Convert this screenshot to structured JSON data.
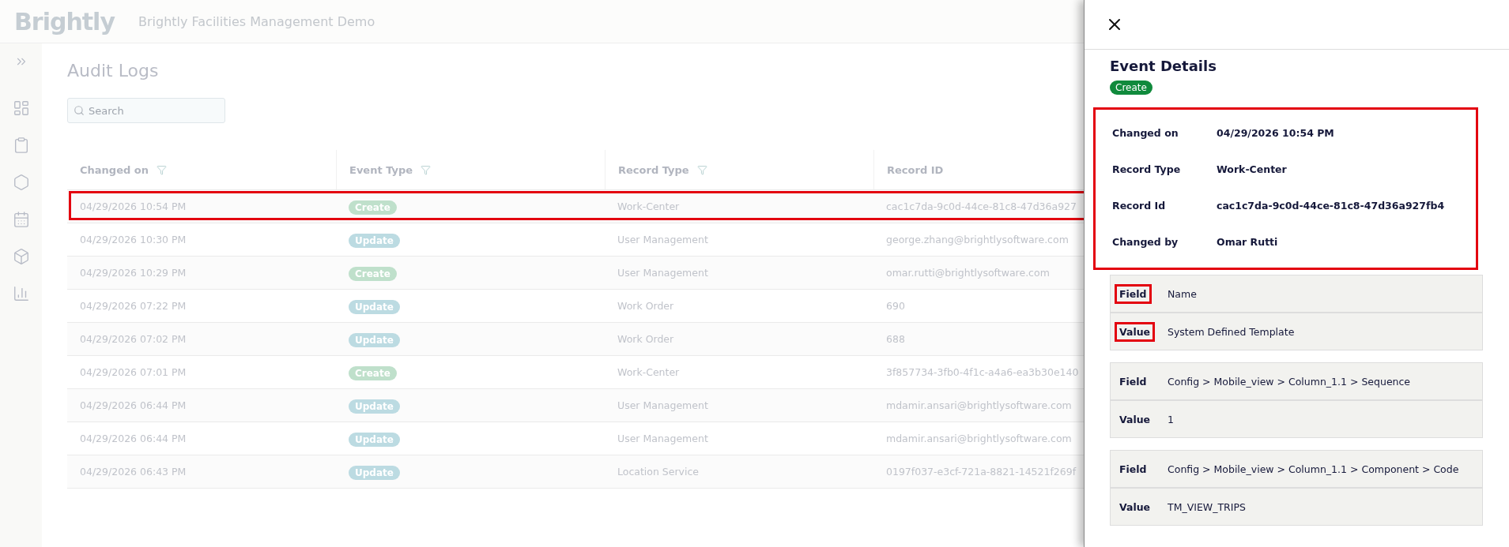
{
  "header": {
    "logo": "Brightly",
    "app_title": "Brightly Facilities Management Demo"
  },
  "sidebar": {
    "items": [
      {
        "kind": "expand"
      },
      {
        "kind": "dashboard"
      },
      {
        "kind": "clipboard"
      },
      {
        "kind": "hexagon"
      },
      {
        "kind": "calendar"
      },
      {
        "kind": "cube"
      },
      {
        "kind": "chart"
      }
    ]
  },
  "page": {
    "title": "Audit Logs",
    "search": {
      "placeholder": "Search"
    }
  },
  "table": {
    "columns": [
      {
        "label": "Changed on",
        "filter": true
      },
      {
        "label": "Event Type",
        "filter": true
      },
      {
        "label": "Record Type",
        "filter": true
      },
      {
        "label": "Record ID",
        "filter": false
      }
    ],
    "rows": [
      {
        "changed_on": "04/29/2026 10:54 PM",
        "event_type": "Create",
        "kind": "create",
        "record_type": "Work-Center",
        "record_id": "cac1c7da-9c0d-44ce-81c8-47d36a927",
        "highlighted": true
      },
      {
        "changed_on": "04/29/2026 10:30 PM",
        "event_type": "Update",
        "kind": "update",
        "record_type": "User Management",
        "record_id": "george.zhang@brightlysoftware.com",
        "highlighted": false
      },
      {
        "changed_on": "04/29/2026 10:29 PM",
        "event_type": "Create",
        "kind": "create",
        "record_type": "User Management",
        "record_id": "omar.rutti@brightlysoftware.com",
        "highlighted": false
      },
      {
        "changed_on": "04/29/2026 07:22 PM",
        "event_type": "Update",
        "kind": "update",
        "record_type": "Work Order",
        "record_id": "690",
        "highlighted": false
      },
      {
        "changed_on": "04/29/2026 07:02 PM",
        "event_type": "Update",
        "kind": "update",
        "record_type": "Work Order",
        "record_id": "688",
        "highlighted": false
      },
      {
        "changed_on": "04/29/2026 07:01 PM",
        "event_type": "Create",
        "kind": "create",
        "record_type": "Work-Center",
        "record_id": "3f857734-3fb0-4f1c-a4a6-ea3b30e140",
        "highlighted": false
      },
      {
        "changed_on": "04/29/2026 06:44 PM",
        "event_type": "Update",
        "kind": "update",
        "record_type": "User Management",
        "record_id": "mdamir.ansari@brightlysoftware.com",
        "highlighted": false
      },
      {
        "changed_on": "04/29/2026 06:44 PM",
        "event_type": "Update",
        "kind": "update",
        "record_type": "User Management",
        "record_id": "mdamir.ansari@brightlysoftware.com",
        "highlighted": false
      },
      {
        "changed_on": "04/29/2026 06:43 PM",
        "event_type": "Update",
        "kind": "update",
        "record_type": "Location Service",
        "record_id": "0197f037-e3cf-721a-8821-14521f269f",
        "highlighted": false
      }
    ]
  },
  "panel": {
    "title": "Event Details",
    "badge": {
      "label": "Create",
      "kind": "create"
    },
    "summary": {
      "highlighted": true,
      "items": [
        {
          "label": "Changed on",
          "value": "04/29/2026 10:54 PM"
        },
        {
          "label": "Record Type",
          "value": "Work-Center"
        },
        {
          "label": "Record Id",
          "value": "cac1c7da-9c0d-44ce-81c8-47d36a927fb4"
        },
        {
          "label": "Changed by",
          "value": "Omar Rutti"
        }
      ]
    },
    "changes": [
      {
        "field_label": "Field",
        "field": "Name",
        "value_label": "Value",
        "value": "System Defined Template",
        "highlighted": true
      },
      {
        "field_label": "Field",
        "field": "Config > Mobile_view > Column_1.1 > Sequence",
        "value_label": "Value",
        "value": "1",
        "highlighted": false
      },
      {
        "field_label": "Field",
        "field": "Config > Mobile_view > Column_1.1 > Component > Code",
        "value_label": "Value",
        "value": "TM_VIEW_TRIPS",
        "highlighted": false
      }
    ]
  }
}
